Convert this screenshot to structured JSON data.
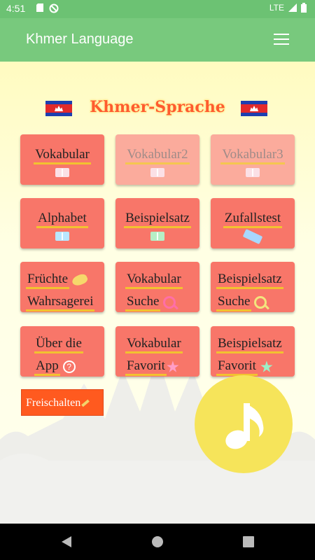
{
  "status_bar": {
    "time": "4:51",
    "network": "LTE"
  },
  "app_bar": {
    "title": "Khmer Language",
    "menu_icon": "hamburger-menu-icon"
  },
  "header": {
    "title": "Khmer-Sprache",
    "flag_icon": "cambodia-flag-icon"
  },
  "tiles": {
    "vocab": {
      "label": "Vokabular",
      "icon": "book-icon"
    },
    "vocab2": {
      "label": "Vokabular2",
      "icon": "book-icon"
    },
    "vocab3": {
      "label": "Vokabular3",
      "icon": "book-icon"
    },
    "alphabet": {
      "label": "Alphabet",
      "icon": "book-icon"
    },
    "example": {
      "label": "Beispielsatz",
      "icon": "book-icon"
    },
    "random": {
      "label": "Zufallstest",
      "icon": "tag-icon"
    },
    "fruit": {
      "line1": "Früchte",
      "line2": "Wahrsagerei",
      "icon": "fruit-icon"
    },
    "vocab_search": {
      "line1": "Vokabular",
      "line2": "Suche",
      "icon": "search-icon"
    },
    "example_search": {
      "line1": "Beispielsatz",
      "line2": "Suche",
      "icon": "search-icon"
    },
    "about": {
      "line1": "Über die",
      "line2": "App",
      "icon": "help-icon"
    },
    "vocab_fav": {
      "line1": "Vokabular",
      "line2": "Favorit",
      "icon": "star-icon"
    },
    "example_fav": {
      "line1": "Beispielsatz",
      "line2": "Favorit",
      "icon": "star-icon"
    }
  },
  "unlock_button": {
    "label": "Freischalten"
  },
  "music_button": {
    "icon": "music-note-icon"
  },
  "colors": {
    "app_bar": "#78c97d",
    "tile": "#f87669",
    "tile_disabled": "#fbab9c",
    "accent_underline": "#f2c230",
    "unlock": "#ff5a1f",
    "music_fab": "#f6e45a"
  }
}
